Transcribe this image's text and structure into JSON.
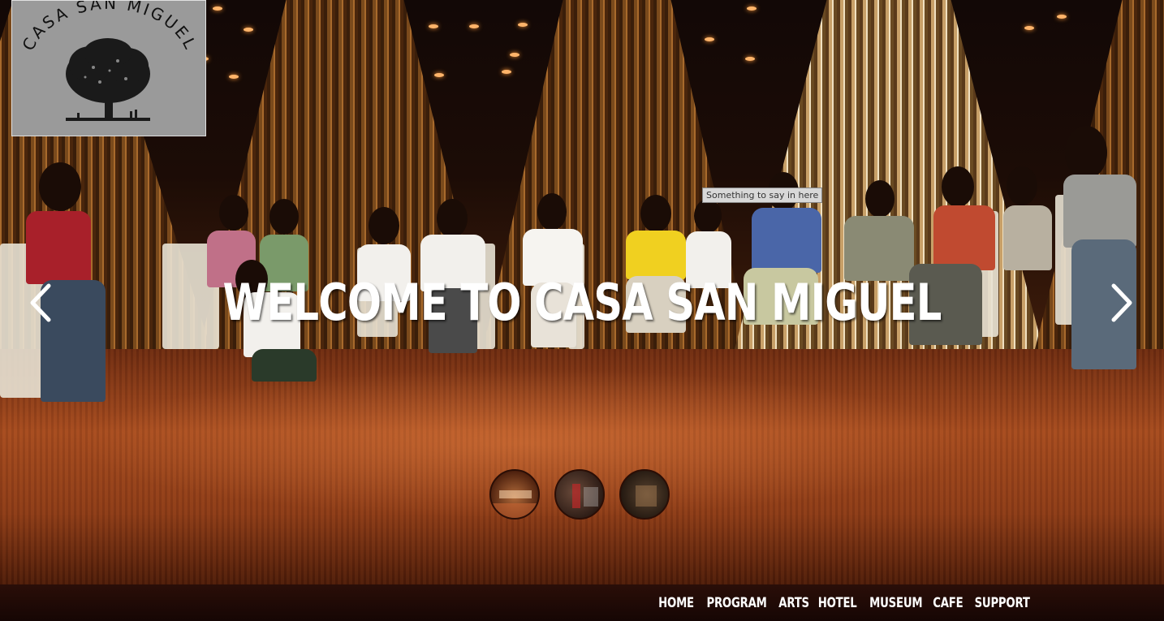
{
  "logo": {
    "text": "CASA SAN MIGUEL",
    "icon": "tree-logo-icon"
  },
  "slider": {
    "headline": "WELCOME TO CASA SAN MIGUEL",
    "tooltip": "Something to say in here",
    "prev_icon": "chevron-left-icon",
    "next_icon": "chevron-right-icon",
    "thumbnails": [
      "slide-1",
      "slide-2",
      "slide-3"
    ]
  },
  "nav": {
    "items": [
      "HOME",
      "PROGRAM",
      "ARTS",
      "HOTEL",
      "MUSEUM",
      "CAFE",
      "SUPPORT"
    ]
  },
  "colors": {
    "nav_background": "#1e0a06",
    "text": "#ffffff",
    "logo_background": "#9a9a9a"
  }
}
